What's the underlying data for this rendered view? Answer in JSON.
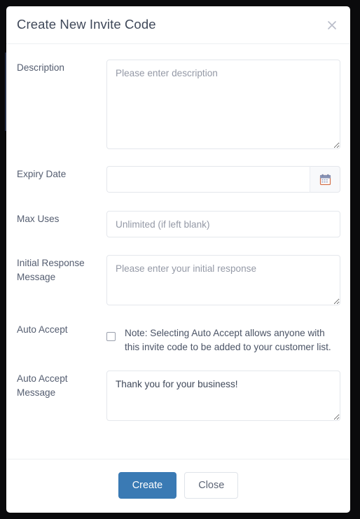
{
  "modal": {
    "title": "Create New Invite Code",
    "close_icon": "close-icon",
    "fields": [
      {
        "key": "description",
        "label": "Description",
        "control": "textarea",
        "placeholder": "Please enter description",
        "value": ""
      },
      {
        "key": "expiry_date",
        "label": "Expiry Date",
        "control": "date",
        "placeholder": "",
        "value": "",
        "addon_icon": "calendar-icon"
      },
      {
        "key": "max_uses",
        "label": "Max Uses",
        "control": "text",
        "placeholder": "Unlimited (if left blank)",
        "value": ""
      },
      {
        "key": "initial_response_message",
        "label": "Initial Response Message",
        "control": "textarea",
        "placeholder": "Please enter your initial response",
        "value": ""
      },
      {
        "key": "auto_accept",
        "label": "Auto Accept",
        "control": "checkbox",
        "checked": false,
        "note": "Note: Selecting Auto Accept allows anyone with this invite code to be added to your customer list."
      },
      {
        "key": "auto_accept_message",
        "label": "Auto Accept Message",
        "control": "textarea",
        "placeholder": "",
        "value": "Thank you for your business!"
      }
    ],
    "footer": {
      "create_label": "Create",
      "close_label": "Close"
    }
  },
  "colors": {
    "primary": "#3a7ab4",
    "backdrop": "#0a0a0c",
    "label_text": "#545d70",
    "title_text": "#3f4859",
    "placeholder_text": "#9499a6",
    "border": "#e4e7ec"
  }
}
